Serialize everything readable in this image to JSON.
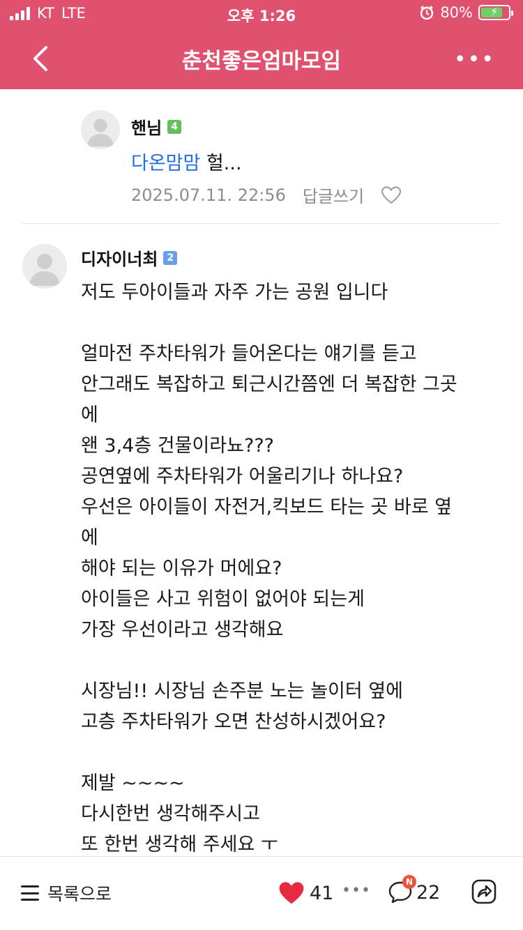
{
  "status": {
    "carrier": "KT",
    "network": "LTE",
    "time": "오후 1:26",
    "battery": "80%"
  },
  "header": {
    "title": "춘천좋은엄마모임"
  },
  "reply": {
    "author": "핸님",
    "badge": "4",
    "mention": "다온맘맘",
    "text": " 헐...",
    "date": "2025.07.11. 22:56",
    "reply_label": "답글쓰기"
  },
  "comment": {
    "author": "디자이너최",
    "badge": "2",
    "lines": [
      "저도 두아이들과 자주 가는 공원 입니다",
      "",
      "얼마전 주차타워가 들어온다는 얘기를 듣고",
      "안그래도 복잡하고 퇴근시간쯤엔 더 복잡한 그곳",
      "에",
      "왠 3,4층 건물이라뇨???",
      "공연옆에 주차타워가 어울리기나 하나요?",
      "우선은 아이들이 자전거,킥보드 타는 곳 바로 옆",
      "에",
      "해야 되는 이유가 머에요?",
      "아이들은 사고 위험이 없어야 되는게",
      "가장 우선이라고 생각해요",
      "",
      "시장님!! 시장님 손주분 노는 놀이터 옆에",
      "고층 주차타워가 오면 찬성하시겠어요?",
      "",
      "제발 ~~~~",
      "다시한번 생각해주시고",
      "또 한번 생각해 주세요 ㅜ"
    ]
  },
  "bottom_bar": {
    "list_label": "목록으로",
    "like_count": "41",
    "comment_count": "22",
    "new_badge": "N"
  },
  "colors": {
    "header_bg": "#e0506f",
    "mention": "#1f6fe5",
    "like_heart": "#e8293f"
  }
}
